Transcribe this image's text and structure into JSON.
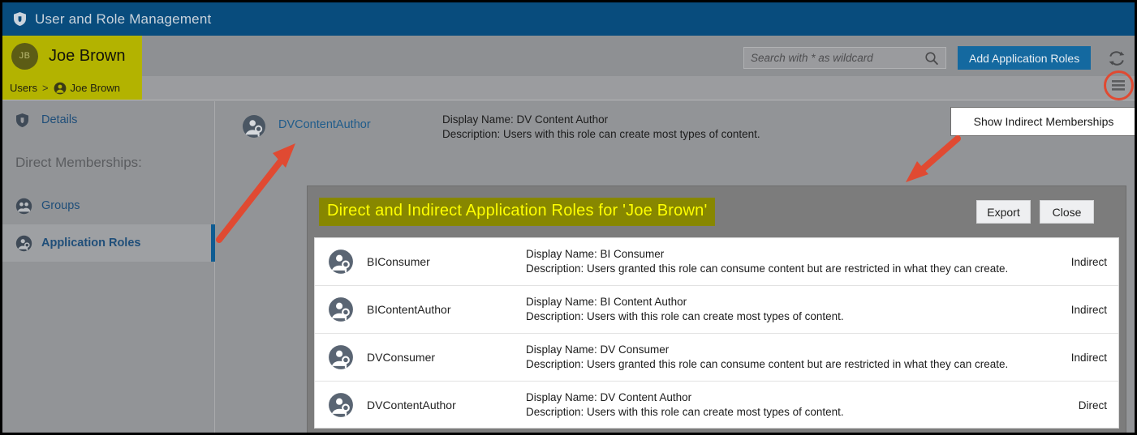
{
  "titlebar": {
    "icon": "shield-icon",
    "title": "User and Role Management"
  },
  "user_header": {
    "avatar_initials": "JB",
    "name": "Joe Brown",
    "highlight_color": "#b3b300"
  },
  "search": {
    "placeholder": "Search with * as wildcard",
    "value": "",
    "icon": "search-icon"
  },
  "toolbar": {
    "add_roles_label": "Add Application Roles",
    "add_roles_color": "#1469a0",
    "refresh_icon": "refresh-icon",
    "menu_icon": "hamburger-menu-icon"
  },
  "breadcrumb": {
    "root": "Users",
    "separator": ">",
    "current": "Joe Brown",
    "user_icon": "user-icon"
  },
  "menu": {
    "items": [
      {
        "label": "Show Indirect Memberships"
      }
    ]
  },
  "sidebar": {
    "details": {
      "label": "Details",
      "icon": "shield-icon"
    },
    "section_label": "Direct Memberships:",
    "items": [
      {
        "label": "Groups",
        "icon": "groups-icon",
        "active": false
      },
      {
        "label": "Application Roles",
        "icon": "role-key-icon",
        "active": true
      }
    ]
  },
  "main": {
    "role": {
      "icon": "role-key-icon",
      "name": "DVContentAuthor",
      "display_name": "Display Name: DV Content Author",
      "description": "Description: Users with this role can create most types of content."
    }
  },
  "dialog": {
    "title": "Direct and Indirect Application Roles for 'Joe Brown'",
    "title_bg": "#878700",
    "title_fg": "#ffff00",
    "export_label": "Export",
    "close_label": "Close",
    "rows": [
      {
        "icon": "role-key-icon",
        "name": "BIConsumer",
        "display_name": "Display Name: BI Consumer",
        "description": "Description: Users granted this role can consume content but are restricted in what they can create.",
        "membership": "Indirect"
      },
      {
        "icon": "role-key-icon",
        "name": "BIContentAuthor",
        "display_name": "Display Name: BI Content Author",
        "description": "Description: Users with this role can create most types of content.",
        "membership": "Indirect"
      },
      {
        "icon": "role-key-icon",
        "name": "DVConsumer",
        "display_name": "Display Name: DV Consumer",
        "description": "Description: Users granted this role can consume content but are restricted in what they can create.",
        "membership": "Indirect"
      },
      {
        "icon": "role-key-icon",
        "name": "DVContentAuthor",
        "display_name": "Display Name: DV Content Author",
        "description": "Description: Users with this role can create most types of content.",
        "membership": "Direct"
      }
    ]
  },
  "annotations": {
    "arrow_color": "#e04a32",
    "highlight_ring_color": "#e04a32"
  }
}
